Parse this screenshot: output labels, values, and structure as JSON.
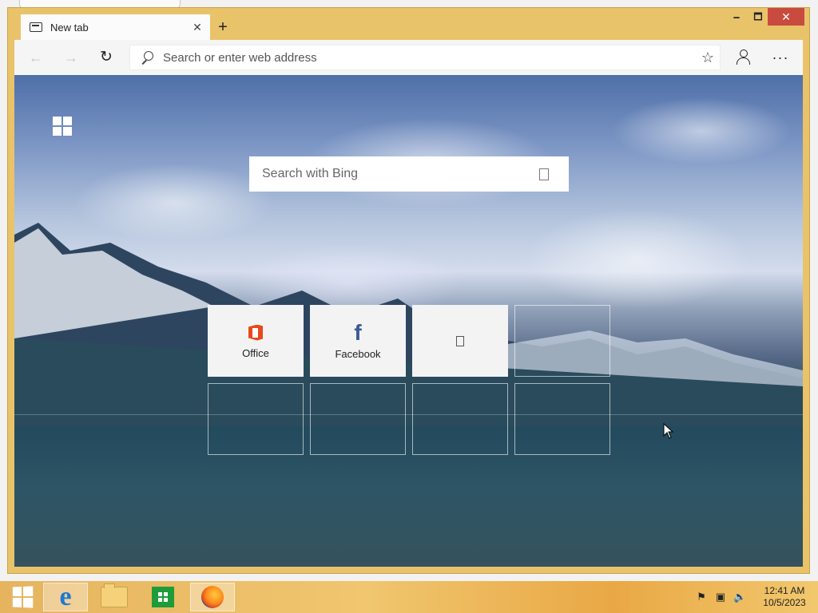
{
  "window": {
    "tab_title": "New tab",
    "tab_close": "✕",
    "new_tab": "+",
    "minimize": "🗕",
    "maximize": "🗖",
    "close": "✕"
  },
  "toolbar": {
    "back": "←",
    "forward": "→",
    "refresh": "↻",
    "address_placeholder": "Search or enter web address",
    "favorite": "☆",
    "more": "···"
  },
  "page": {
    "search_placeholder": "Search with Bing",
    "tiles": [
      {
        "label": "Office",
        "icon": "office-icon"
      },
      {
        "label": "Facebook",
        "icon": "facebook-icon"
      },
      {
        "label": "",
        "icon": "placeholder-icon"
      }
    ]
  },
  "taskbar": {
    "apps": [
      "start",
      "microsoft-edge",
      "file-explorer",
      "store",
      "firefox"
    ],
    "time": "12:41 AM",
    "date": "10/5/2023"
  },
  "colors": {
    "window_frame": "#e9c36a",
    "close_button": "#c94b3f",
    "edge_blue": "#1b7ad3",
    "facebook_blue": "#3b5998",
    "office_orange": "#e64a19"
  }
}
